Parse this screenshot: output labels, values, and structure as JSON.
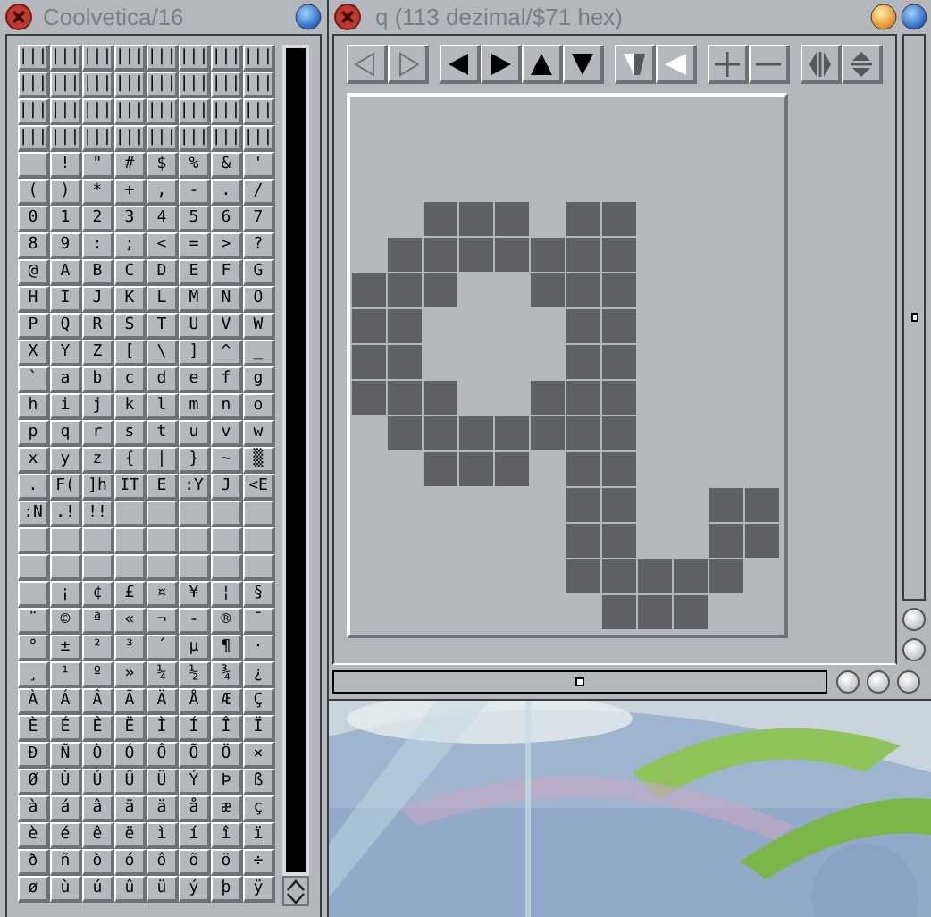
{
  "font_window": {
    "title": "Coolvetica/16",
    "glyph_rows": [
      [
        "|||",
        "|||",
        "|||",
        "|||",
        "|||",
        "|||",
        "|||",
        "|||"
      ],
      [
        "|||",
        "|||",
        "|||",
        "|||",
        "|||",
        "|||",
        "|||",
        "|||"
      ],
      [
        "|||",
        "|||",
        "|||",
        "|||",
        "|||",
        "|||",
        "|||",
        "|||"
      ],
      [
        "|||",
        "|||",
        "|||",
        "|||",
        "|||",
        "|||",
        "|||",
        "|||"
      ],
      [
        null,
        "!",
        "\"",
        "#",
        "$",
        "%",
        "&",
        "'"
      ],
      [
        "(",
        ")",
        "*",
        "+",
        ",",
        "-",
        ".",
        "/"
      ],
      [
        "0",
        "1",
        "2",
        "3",
        "4",
        "5",
        "6",
        "7"
      ],
      [
        "8",
        "9",
        ":",
        ";",
        "<",
        "=",
        ">",
        "?"
      ],
      [
        "@",
        "A",
        "B",
        "C",
        "D",
        "E",
        "F",
        "G"
      ],
      [
        "H",
        "I",
        "J",
        "K",
        "L",
        "M",
        "N",
        "O"
      ],
      [
        "P",
        "Q",
        "R",
        "S",
        "T",
        "U",
        "V",
        "W"
      ],
      [
        "X",
        "Y",
        "Z",
        "[",
        "\\",
        "]",
        "^",
        "_"
      ],
      [
        "`",
        "a",
        "b",
        "c",
        "d",
        "e",
        "f",
        "g"
      ],
      [
        "h",
        "i",
        "j",
        "k",
        "l",
        "m",
        "n",
        "o"
      ],
      [
        "p",
        "q",
        "r",
        "s",
        "t",
        "u",
        "v",
        "w"
      ],
      [
        "x",
        "y",
        "z",
        "{",
        "|",
        "}",
        "~",
        "▒"
      ],
      [
        ".",
        "F(",
        "]h",
        "IT",
        "E",
        ":Y",
        "J",
        "<E"
      ],
      [
        ":N",
        ".!",
        "!!",
        null,
        null,
        null,
        null,
        null
      ],
      [
        null,
        null,
        null,
        null,
        null,
        null,
        null,
        null
      ],
      [
        null,
        null,
        null,
        null,
        null,
        null,
        null,
        null
      ],
      [
        null,
        "¡",
        "¢",
        "£",
        "¤",
        "¥",
        "¦",
        "§"
      ],
      [
        "¨",
        "©",
        "ª",
        "«",
        "¬",
        "-",
        "®",
        "¯"
      ],
      [
        "°",
        "±",
        "²",
        "³",
        "´",
        "µ",
        "¶",
        "·"
      ],
      [
        "¸",
        "¹",
        "º",
        "»",
        "¼",
        "½",
        "¾",
        "¿"
      ],
      [
        "À",
        "Á",
        "Â",
        "Ã",
        "Ä",
        "Å",
        "Æ",
        "Ç"
      ],
      [
        "È",
        "É",
        "Ê",
        "Ë",
        "Ì",
        "Í",
        "Î",
        "Ï"
      ],
      [
        "Ð",
        "Ñ",
        "Ò",
        "Ó",
        "Ô",
        "Õ",
        "Ö",
        "×"
      ],
      [
        "Ø",
        "Ù",
        "Ú",
        "Û",
        "Ü",
        "Ý",
        "Þ",
        "ß"
      ],
      [
        "à",
        "á",
        "â",
        "ã",
        "ä",
        "å",
        "æ",
        "ç"
      ],
      [
        "è",
        "é",
        "ê",
        "ë",
        "ì",
        "í",
        "î",
        "ï"
      ],
      [
        "ð",
        "ñ",
        "ò",
        "ó",
        "ô",
        "õ",
        "ö",
        "÷"
      ],
      [
        "ø",
        "ù",
        "ú",
        "û",
        "ü",
        "ý",
        "þ",
        "ÿ"
      ]
    ]
  },
  "editor_window": {
    "title": "q (113 dezimal/$71 hex)"
  }
}
